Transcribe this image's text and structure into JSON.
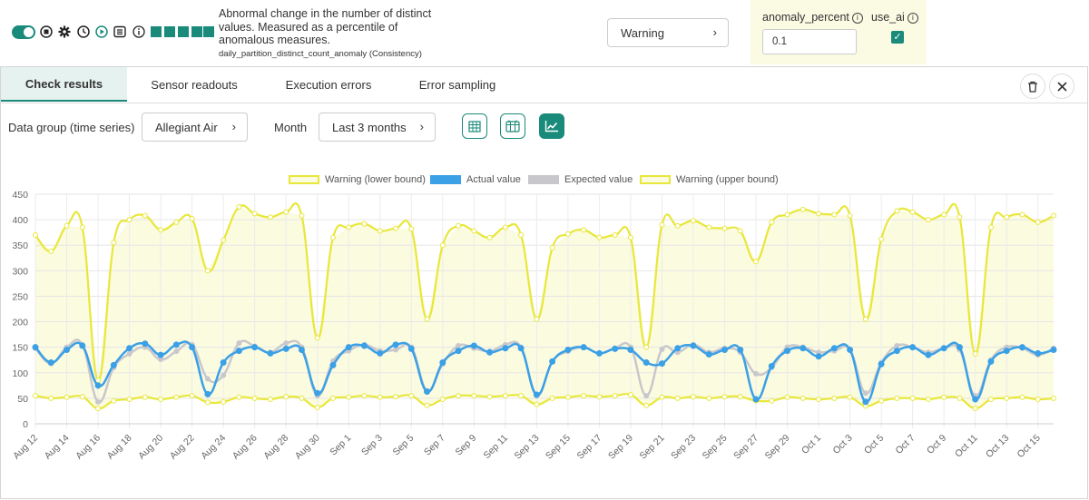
{
  "check": {
    "description": "Abnormal change in the number of distinct values. Measured as a percentile of anomalous measures.",
    "name": "daily_partition_distinct_count_anomaly (Consistency)",
    "severity_value": "Warning",
    "params": {
      "anomaly_percent_label": "anomaly_percent",
      "anomaly_percent_value": "0.1",
      "use_ai_label": "use_ai",
      "use_ai_checked": true
    }
  },
  "tabs": [
    {
      "label": "Check results",
      "active": true
    },
    {
      "label": "Sensor readouts",
      "active": false
    },
    {
      "label": "Execution errors",
      "active": false
    },
    {
      "label": "Error sampling",
      "active": false
    }
  ],
  "filters": {
    "data_group_label": "Data group (time series)",
    "data_group_value": "Allegiant Air",
    "month_label": "Month",
    "month_value": "Last 3 months"
  },
  "colors": {
    "accent": "#1a8a7a",
    "warning": "#e8e73a",
    "actual": "#3ba0e6",
    "expected": "#c8c8cc",
    "band_fill": "#fbfbe0"
  },
  "chart_data": {
    "type": "line",
    "ylim": [
      0,
      450
    ],
    "yticks": [
      0,
      50,
      100,
      150,
      200,
      250,
      300,
      350,
      400,
      450
    ],
    "legend": [
      "Warning (lower bound)",
      "Actual value",
      "Expected value",
      "Warning (upper bound)"
    ],
    "xtick_labels": [
      "Aug 12",
      "Aug 14",
      "Aug 16",
      "Aug 18",
      "Aug 20",
      "Aug 22",
      "Aug 24",
      "Aug 26",
      "Aug 28",
      "Aug 30",
      "Sep 1",
      "Sep 3",
      "Sep 5",
      "Sep 7",
      "Sep 9",
      "Sep 11",
      "Sep 13",
      "Sep 15",
      "Sep 17",
      "Sep 19",
      "Sep 21",
      "Sep 23",
      "Sep 25",
      "Sep 27",
      "Sep 29",
      "Oct 1",
      "Oct 3",
      "Oct 5",
      "Oct 7",
      "Oct 9",
      "Oct 11",
      "Oct 13",
      "Oct 15"
    ],
    "series": [
      {
        "name": "Warning (upper bound)",
        "values": [
          370,
          338,
          388,
          385,
          85,
          355,
          400,
          408,
          380,
          395,
          402,
          300,
          360,
          425,
          412,
          405,
          415,
          408,
          168,
          365,
          385,
          392,
          378,
          383,
          382,
          205,
          350,
          388,
          378,
          365,
          385,
          370,
          205,
          345,
          372,
          380,
          365,
          370,
          365,
          150,
          390,
          388,
          398,
          385,
          383,
          378,
          318,
          395,
          410,
          420,
          412,
          410,
          408,
          205,
          362,
          417,
          415,
          400,
          410,
          405,
          137,
          385,
          405,
          410,
          395,
          408
        ]
      },
      {
        "name": "Actual value",
        "values": [
          150,
          120,
          145,
          153,
          75,
          115,
          148,
          157,
          135,
          155,
          150,
          58,
          120,
          143,
          150,
          138,
          147,
          145,
          60,
          115,
          150,
          153,
          138,
          155,
          147,
          63,
          120,
          143,
          153,
          140,
          148,
          148,
          57,
          122,
          145,
          150,
          138,
          147,
          145,
          120,
          118,
          148,
          153,
          136,
          145,
          145,
          48,
          113,
          143,
          148,
          132,
          148,
          145,
          43,
          117,
          143,
          150,
          135,
          148,
          150,
          48,
          122,
          143,
          150,
          138,
          145
        ]
      },
      {
        "name": "Expected value",
        "values": [
          148,
          118,
          150,
          155,
          43,
          110,
          137,
          150,
          126,
          142,
          155,
          88,
          95,
          158,
          152,
          140,
          158,
          150,
          55,
          123,
          143,
          155,
          143,
          145,
          150,
          65,
          117,
          153,
          148,
          142,
          155,
          150,
          55,
          122,
          142,
          150,
          138,
          148,
          150,
          55,
          146,
          140,
          155,
          140,
          148,
          140,
          98,
          110,
          150,
          150,
          140,
          143,
          145,
          60,
          120,
          153,
          150,
          140,
          148,
          145,
          55,
          125,
          150,
          148,
          135,
          148
        ]
      },
      {
        "name": "Warning (lower bound)",
        "values": [
          55,
          50,
          52,
          53,
          30,
          45,
          48,
          52,
          48,
          52,
          55,
          42,
          43,
          52,
          50,
          48,
          53,
          50,
          32,
          50,
          52,
          55,
          52,
          53,
          55,
          36,
          48,
          55,
          55,
          53,
          55,
          55,
          38,
          50,
          52,
          55,
          53,
          55,
          57,
          36,
          52,
          50,
          53,
          50,
          53,
          53,
          45,
          45,
          52,
          50,
          48,
          50,
          52,
          35,
          45,
          50,
          50,
          48,
          52,
          50,
          30,
          48,
          50,
          52,
          48,
          50
        ]
      }
    ]
  }
}
